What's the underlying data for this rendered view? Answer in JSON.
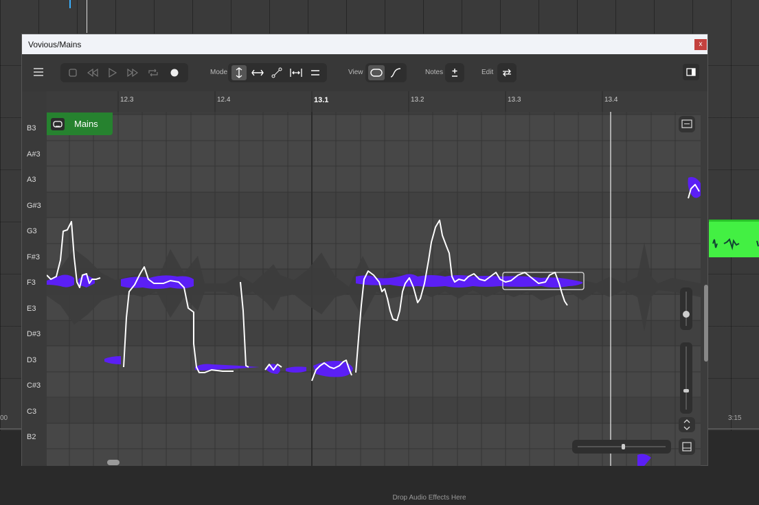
{
  "window": {
    "title": "Vovious/Mains",
    "close_label": "x"
  },
  "toolbar": {
    "mode_label": "Mode",
    "view_label": "View",
    "notes_label": "Notes",
    "edit_label": "Edit"
  },
  "background": {
    "timeline_left": "00",
    "timeline_right": "3:15",
    "drop_text": "Drop Audio Effects Here"
  },
  "ruler": {
    "labels": [
      "12.3",
      "12.4",
      "13.1",
      "13.2",
      "13.3",
      "13.4"
    ]
  },
  "keys": [
    "B3",
    "A#3",
    "A3",
    "G#3",
    "G3",
    "F#3",
    "F3",
    "E3",
    "D#3",
    "D3",
    "C#3",
    "C3",
    "B2"
  ],
  "track": {
    "name": "Mains"
  },
  "colors": {
    "note_blob": "#5b1ff5",
    "pitch_curve": "#ffffff",
    "track_green": "#26822f",
    "clip_green": "#43f043"
  }
}
